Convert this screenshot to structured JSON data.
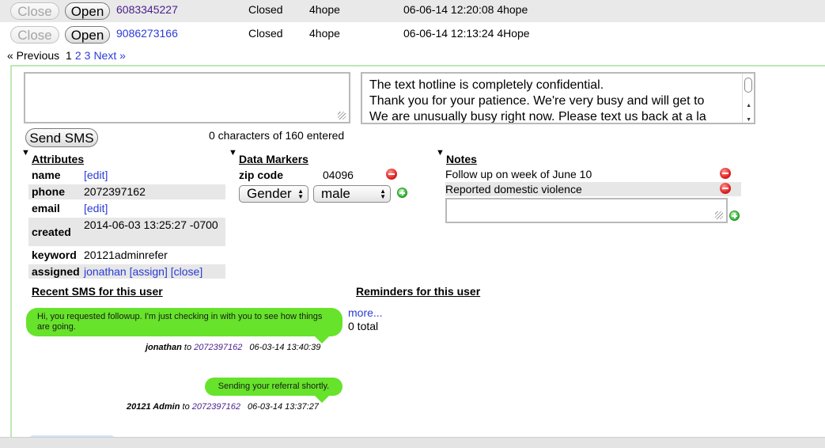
{
  "list": {
    "rows": [
      {
        "close": "Close",
        "open": "Open",
        "phone": "6083345227",
        "status": "Closed",
        "keyword": "4hope",
        "timestamp": "06-06-14 12:20:08 4hope"
      },
      {
        "close": "Close",
        "open": "Open",
        "phone": "9086273166",
        "status": "Closed",
        "keyword": "4hope",
        "timestamp": "06-06-14 12:13:24 4Hope"
      }
    ]
  },
  "pager": {
    "previous": "« Previous",
    "current": "1",
    "page2": "2",
    "page3": "3",
    "next": "Next »"
  },
  "compose": {
    "message_value": "",
    "canned_lines": [
      "The text hotline is completely confidential.",
      "Thank you for your patience. We're very busy and will get to",
      "We are unusually busy right now. Please text us back at a la"
    ],
    "send_label": "Send SMS",
    "char_count": "0 characters of 160 entered"
  },
  "attributes": {
    "heading": "Attributes",
    "rows": [
      {
        "label": "name",
        "value": "[edit]"
      },
      {
        "label": "phone",
        "value": "2072397162"
      },
      {
        "label": "email",
        "value": "[edit]"
      },
      {
        "label": "created",
        "value": "2014-06-03 13:25:27 -0700"
      },
      {
        "label": "keyword",
        "value": "20121adminrefer"
      },
      {
        "label": "assigned",
        "value": "jonathan",
        "assign": "[assign]",
        "close": "[close]"
      }
    ]
  },
  "data_markers": {
    "heading": "Data Markers",
    "zip_label": "zip code",
    "zip_value": "04096",
    "select_field": "Gender",
    "select_value": "male"
  },
  "notes": {
    "heading": "Notes",
    "items": [
      "Follow up on week of June 10",
      "Reported domestic violence"
    ],
    "new_note_value": ""
  },
  "recent_sms": {
    "heading": "Recent SMS for this user",
    "messages": [
      {
        "text": "Hi, you requested followup. I'm just checking in with you to see how things are going.",
        "sender": "jonathan",
        "to": "to",
        "phone": "2072397162",
        "time": "06-03-14 13:40:39"
      },
      {
        "text": "Sending your referral shortly.",
        "sender": "20121 Admin",
        "to": "to",
        "phone": "2072397162",
        "time": "06-03-14 13:37:27"
      }
    ]
  },
  "reminders": {
    "heading": "Reminders for this user",
    "more": "more...",
    "total": "0 total"
  },
  "colors": {
    "bubble": "#66e32a",
    "link": "#2a3bd6",
    "panel_border": "#bfe7b5"
  }
}
